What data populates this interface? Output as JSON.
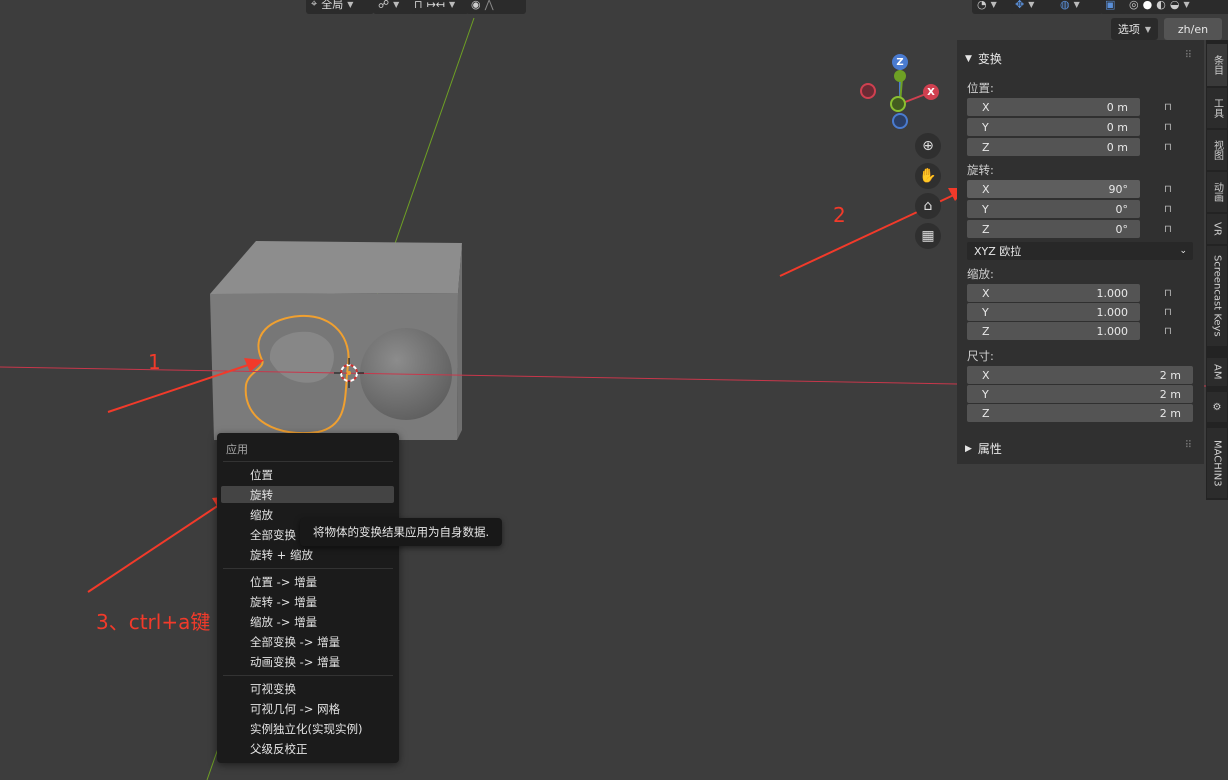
{
  "header": {
    "global_label": "全局",
    "snap_label": "↦↤"
  },
  "options": {
    "options_label": "选项",
    "lang_label": "zh/en"
  },
  "sidebar": {
    "transform_title": "变换",
    "location": {
      "label": "位置:",
      "x_label": "X",
      "x": "0 m",
      "y_label": "Y",
      "y": "0 m",
      "z_label": "Z",
      "z": "0 m"
    },
    "rotation": {
      "label": "旋转:",
      "x_label": "X",
      "x": "90°",
      "y_label": "Y",
      "y": "0°",
      "z_label": "Z",
      "z": "0°"
    },
    "rotation_mode": "XYZ 欧拉",
    "scale": {
      "label": "缩放:",
      "x_label": "X",
      "x": "1.000",
      "y_label": "Y",
      "y": "1.000",
      "z_label": "Z",
      "z": "1.000"
    },
    "dimensions": {
      "label": "尺寸:",
      "x_label": "X",
      "x": "2 m",
      "y_label": "Y",
      "y": "2 m",
      "z_label": "Z",
      "z": "2 m"
    },
    "properties_title": "属性"
  },
  "tabs": [
    "条目",
    "工具",
    "视图",
    "动画",
    "VR",
    "Screencast Keys",
    "AM",
    "MACHIN3"
  ],
  "gizmo": {
    "z": "Z",
    "x": "X"
  },
  "menu": {
    "title": "应用",
    "group1": [
      "位置",
      "旋转",
      "缩放",
      "全部变换",
      "旋转 + 缩放"
    ],
    "group2": [
      "位置 -> 增量",
      "旋转 -> 增量",
      "缩放 -> 增量",
      "全部变换 -> 增量",
      "动画变换 -> 增量"
    ],
    "group3": [
      "可视变换",
      "可视几何 -> 网格",
      "实例独立化(实现实例)",
      "父级反校正"
    ],
    "hovered": "旋转"
  },
  "tooltip": "将物体的变换结果应用为自身数据.",
  "annotations": {
    "a1": "1",
    "a2": "2",
    "a3": "3、ctrl+a键"
  },
  "colors": {
    "annotation_red": "#f23a2a",
    "selection_orange": "#f0a030",
    "axis_x_red": "#c8374b",
    "axis_y_green": "#6ea024"
  }
}
